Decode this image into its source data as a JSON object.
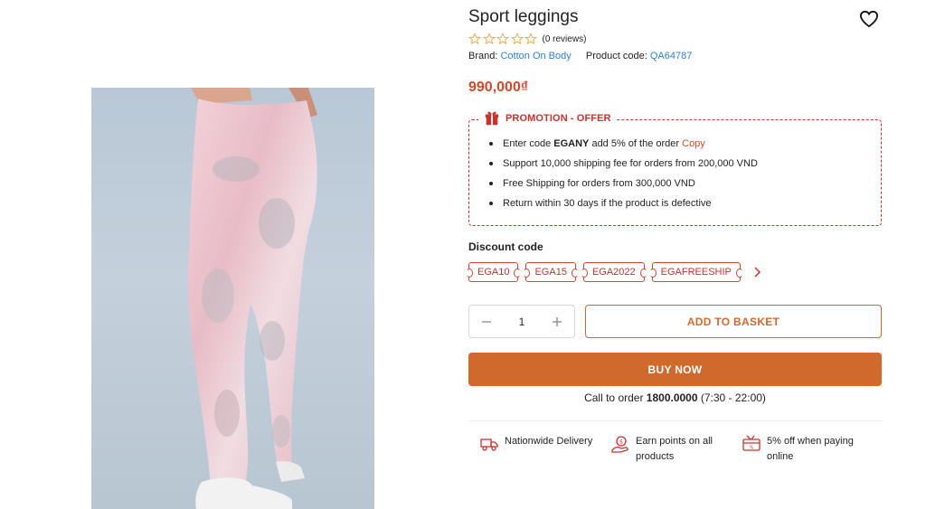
{
  "product": {
    "title": "Sport leggings",
    "reviews": "(0 reviews)",
    "rating_stars": 5,
    "brand_label": "Brand:",
    "brand_value": "Cotton On Body",
    "code_label": "Product code:",
    "code_value": "QA64787",
    "price": "990,000₫"
  },
  "promotion": {
    "title": "PROMOTION - OFFER",
    "items": [
      {
        "prefix": "Enter code ",
        "bold": "EGANY",
        "suffix": " add 5% of the order ",
        "link": "Copy"
      },
      {
        "text": "Support 10,000 shipping fee for orders from 200,000 VND"
      },
      {
        "text": "Free Shipping for orders from 300,000 VND"
      },
      {
        "text": "Return within 30 days if the product is defective"
      }
    ]
  },
  "discount": {
    "label": "Discount code",
    "codes": [
      "EGA10",
      "EGA15",
      "EGA2022",
      "EGAFREESHIP"
    ]
  },
  "purchase": {
    "quantity": "1",
    "add_to_basket": "ADD TO BASKET",
    "buy_now": "BUY NOW",
    "call_prefix": "Call to order ",
    "call_number": "1800.0000",
    "call_hours": " (7:30 - 22:00)"
  },
  "features": [
    {
      "label": "Nationwide Delivery",
      "icon": "truck-icon"
    },
    {
      "label": "Earn points on all products",
      "icon": "coin-hand-icon"
    },
    {
      "label": "5% off when paying online",
      "icon": "card-icon"
    }
  ],
  "colors": {
    "price": "#d0492a",
    "accent": "#cf6a2c",
    "promo_border": "#c8322e",
    "link": "#2f7fd0"
  }
}
